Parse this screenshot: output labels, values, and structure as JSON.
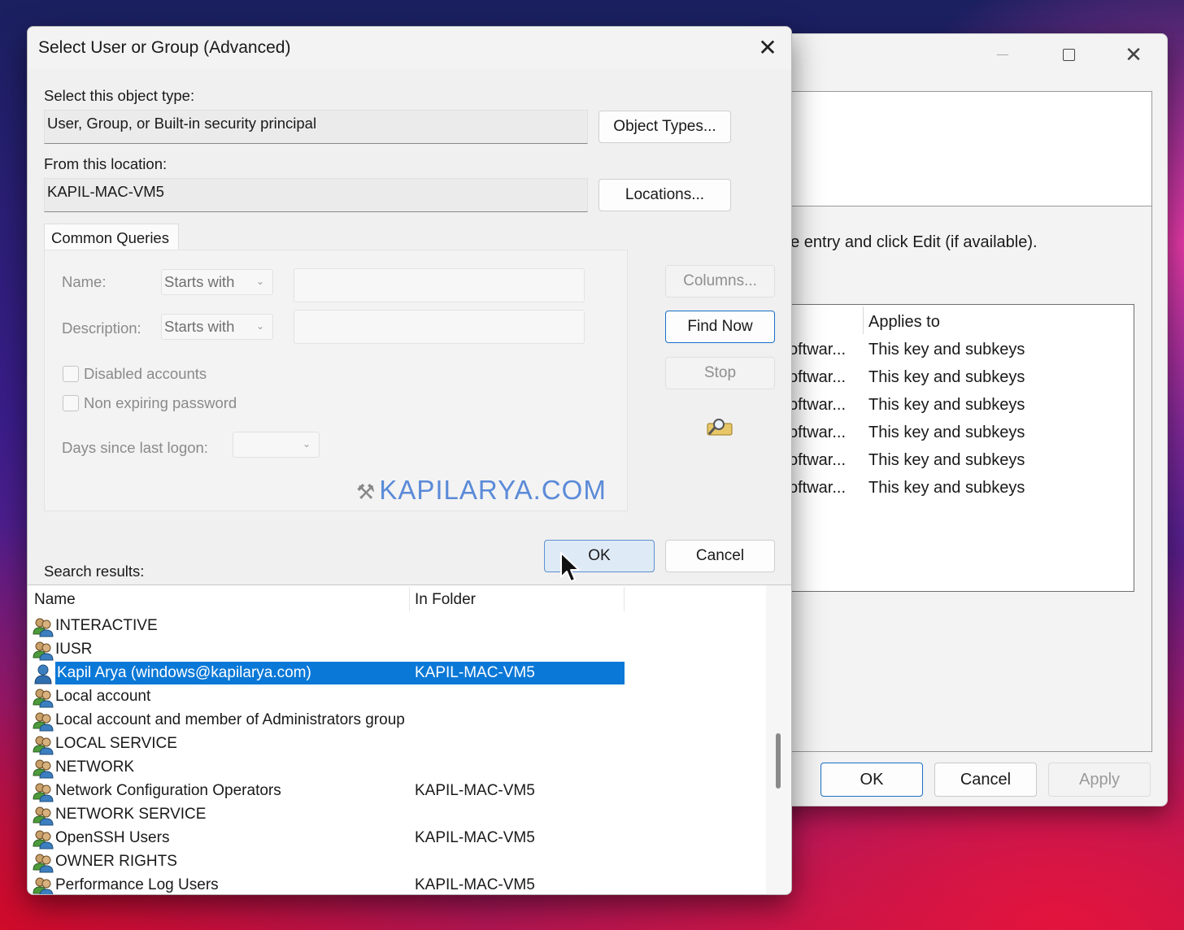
{
  "background_window": {
    "hint_text": "ne entry and click Edit (if available).",
    "table": {
      "applies_to_header": "Applies to",
      "rows": [
        {
          "source": "oftwar...",
          "applies_to": "This key and subkeys"
        },
        {
          "source": "oftwar...",
          "applies_to": "This key and subkeys"
        },
        {
          "source": "oftwar...",
          "applies_to": "This key and subkeys"
        },
        {
          "source": "oftwar...",
          "applies_to": "This key and subkeys"
        },
        {
          "source": "oftwar...",
          "applies_to": "This key and subkeys"
        },
        {
          "source": "oftwar...",
          "applies_to": "This key and subkeys"
        }
      ]
    },
    "buttons": {
      "ok": "OK",
      "cancel": "Cancel",
      "apply": "Apply"
    }
  },
  "dialog": {
    "title": "Select User or Group (Advanced)",
    "object_type": {
      "label": "Select this object type:",
      "value": "User, Group, or Built-in security principal",
      "button": "Object Types..."
    },
    "location": {
      "label": "From this location:",
      "value": "KAPIL-MAC-VM5",
      "button": "Locations..."
    },
    "common_queries": {
      "tab_label": "Common Queries",
      "name_label": "Name:",
      "name_mode": "Starts with",
      "description_label": "Description:",
      "description_mode": "Starts with",
      "disabled_accounts": "Disabled accounts",
      "non_expiring_password": "Non expiring password",
      "days_since_logon_label": "Days since last logon:",
      "watermark": "KAPILARYA.COM"
    },
    "side_buttons": {
      "columns": "Columns...",
      "find_now": "Find Now",
      "stop": "Stop"
    },
    "ok": "OK",
    "cancel": "Cancel",
    "search_results": {
      "label": "Search results:",
      "columns": {
        "name": "Name",
        "folder": "In Folder"
      },
      "rows": [
        {
          "name": "INTERACTIVE",
          "folder": "",
          "icon": "group-icon"
        },
        {
          "name": "IUSR",
          "folder": "",
          "icon": "group-icon"
        },
        {
          "name": "Kapil Arya (windows@kapilarya.com)",
          "folder": "KAPIL-MAC-VM5",
          "icon": "user-icon",
          "selected": true
        },
        {
          "name": "Local account",
          "folder": "",
          "icon": "group-icon"
        },
        {
          "name": "Local account and member of Administrators group",
          "folder": "",
          "icon": "group-icon"
        },
        {
          "name": "LOCAL SERVICE",
          "folder": "",
          "icon": "group-icon"
        },
        {
          "name": "NETWORK",
          "folder": "",
          "icon": "group-icon"
        },
        {
          "name": "Network Configuration Operators",
          "folder": "KAPIL-MAC-VM5",
          "icon": "group-icon"
        },
        {
          "name": "NETWORK SERVICE",
          "folder": "",
          "icon": "group-icon"
        },
        {
          "name": "OpenSSH Users",
          "folder": "KAPIL-MAC-VM5",
          "icon": "group-icon"
        },
        {
          "name": "OWNER RIGHTS",
          "folder": "",
          "icon": "group-icon"
        },
        {
          "name": "Performance Log Users",
          "folder": "KAPIL-MAC-VM5",
          "icon": "group-icon"
        }
      ]
    }
  },
  "colors": {
    "accent": "#0a78d7",
    "watermark": "#5b8ad8"
  }
}
